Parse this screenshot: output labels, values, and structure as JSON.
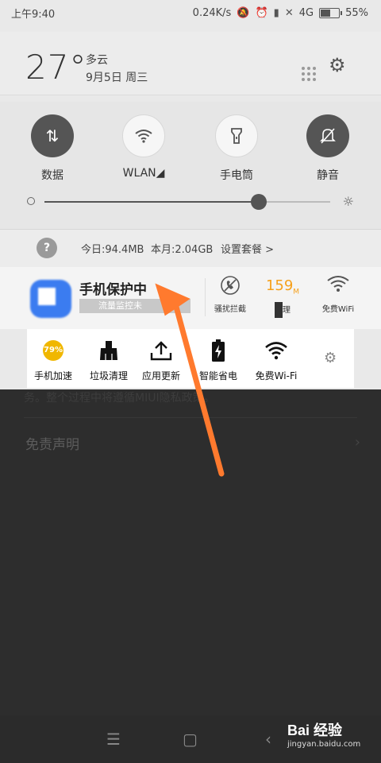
{
  "status_bar": {
    "time": "上午9:40",
    "net_speed": "0.24K/s",
    "network": "4G",
    "battery_pct": "55%",
    "battery_level": 0.55
  },
  "header": {
    "temperature": "27°",
    "weather": "多云",
    "date": "9月5日 周三"
  },
  "toggles": [
    {
      "label": "数据",
      "state": "on",
      "icon": "data-arrows-icon"
    },
    {
      "label": "WLAN◢",
      "state": "off",
      "icon": "wifi-icon"
    },
    {
      "label": "手电筒",
      "state": "off",
      "icon": "flashlight-icon"
    },
    {
      "label": "静音",
      "state": "on",
      "icon": "bell-off-icon"
    }
  ],
  "brightness": {
    "level": 0.75
  },
  "data_usage": {
    "help_symbol": "?",
    "today": "今日:94.4MB",
    "month": "本月:2.04GB",
    "settings": "设置套餐 >"
  },
  "security_notification": {
    "title": "手机保护中",
    "status": "流量监控未",
    "items": [
      {
        "label": "骚扰拦截",
        "icon": "no-disturb-icon"
      },
      {
        "label": "理",
        "speed_value": "159",
        "speed_unit": "M",
        "icon": "speed-icon"
      },
      {
        "label": "免费WiFi",
        "icon": "wifi-icon"
      }
    ]
  },
  "shortcuts": [
    {
      "label": "手机加速",
      "badge": "79%",
      "icon": "boost-icon"
    },
    {
      "label": "垃圾清理",
      "icon": "broom-icon"
    },
    {
      "label": "应用更新",
      "icon": "upload-icon"
    },
    {
      "label": "智能省电",
      "icon": "battery-bolt-icon"
    },
    {
      "label": "免费Wi-Fi",
      "icon": "wifi-icon"
    }
  ],
  "background_app": {
    "partial_text": "务。整个过程中将遵循MIUI隐私政策。",
    "disclaimer": "免责声明",
    "chevron": "›"
  },
  "nav_bar": {
    "menu": "☰",
    "home": "▢",
    "back": "‹"
  },
  "watermark": {
    "logo": "Bai 经验",
    "url": "jingyan.baidu.com"
  },
  "colors": {
    "accent_orange": "#f6a01a",
    "arrow": "#ff7a2e",
    "boost_badge": "#f0b700",
    "security_blue": "#3b7cf0"
  }
}
